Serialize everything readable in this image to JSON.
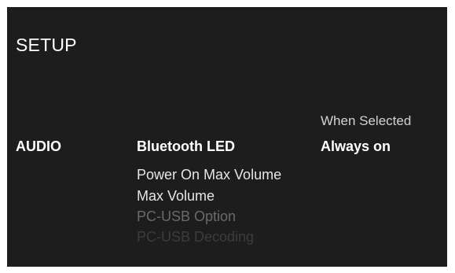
{
  "screen_title": "SETUP",
  "category": "AUDIO",
  "menu_items": [
    {
      "label": "Bluetooth LED",
      "state": "selected"
    },
    {
      "label": "Power On Max Volume",
      "state": "normal"
    },
    {
      "label": "Max Volume",
      "state": "normal"
    },
    {
      "label": "PC-USB Option",
      "state": "dim"
    },
    {
      "label": "PC-USB Decoding",
      "state": "dimmer"
    }
  ],
  "option": {
    "header": "When Selected",
    "value": "Always on"
  },
  "colors": {
    "background": "#1d1d1d",
    "text_active": "#ffffff",
    "text_dim": "#6a6a6a"
  }
}
